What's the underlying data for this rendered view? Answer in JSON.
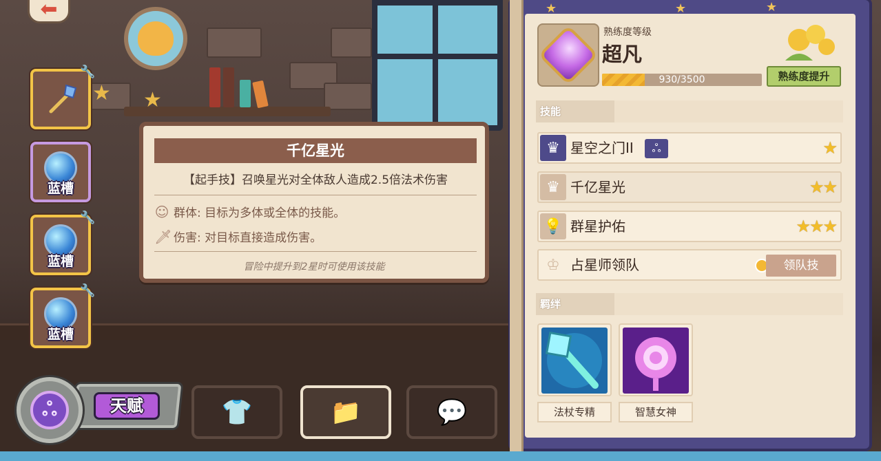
{
  "slots": [
    {
      "label": "",
      "type": "staff"
    },
    {
      "label": "蓝槽",
      "type": "gem"
    },
    {
      "label": "蓝槽",
      "type": "gem"
    },
    {
      "label": "蓝槽",
      "type": "gem"
    }
  ],
  "bottom_bar": {
    "talent_label": "天赋"
  },
  "tooltip": {
    "title": "千亿星光",
    "description": "【起手技】召唤星光对全体敌人造成2.5倍法术伤害",
    "tag1": "群体: 目标为多体或全体的技能。",
    "tag2": "伤害: 对目标直接造成伤害。",
    "note": "冒险中提升到2星时可使用该技能"
  },
  "proficiency": {
    "label": "熟练度等级",
    "rank": "超凡",
    "xp_text": "930/3500",
    "xp_fraction": 0.266,
    "upgrade_button": "熟练度提升"
  },
  "skills_section": {
    "title": "技能",
    "items": [
      {
        "name": "星空之门II",
        "stars": "★",
        "badge": "ஃ",
        "icon_name": "crown-star-icon"
      },
      {
        "name": "千亿星光",
        "stars": "★★",
        "icon_name": "crown-star-icon"
      },
      {
        "name": "群星护佑",
        "stars": "★★★",
        "icon_name": "shield-bulb-icon"
      },
      {
        "name": "占星师领队",
        "leader_button": "领队技",
        "icon_name": "crown-icon"
      }
    ]
  },
  "bonds_section": {
    "title": "羁绊",
    "items": [
      {
        "label": "法杖专精",
        "icon_name": "staff-icon"
      },
      {
        "label": "智慧女神",
        "icon_name": "scepter-icon"
      }
    ]
  },
  "colors": {
    "panel_frame": "#4f4a86",
    "parchment": "#f2e6d2",
    "accent_gold": "#f3b834",
    "tooltip_title": "#8b5e4c"
  }
}
